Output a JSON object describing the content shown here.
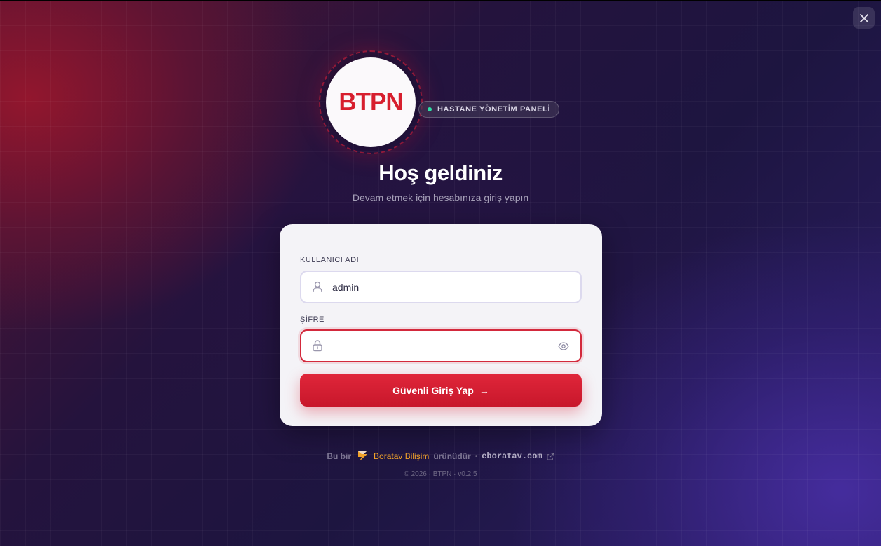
{
  "window": {
    "close_label": "✕"
  },
  "logo": {
    "text": "BTPN"
  },
  "badge": {
    "text": "HASTANE YÖNETİM PANELİ",
    "dot_color": "#2fe0a5"
  },
  "header": {
    "title": "Hoş geldiniz",
    "subtitle": "Devam etmek için hesabınıza giriş yapın"
  },
  "form": {
    "username": {
      "label": "KULLANICI ADI",
      "value": "admin",
      "icon": "user-icon"
    },
    "password": {
      "label": "ŞİFRE",
      "value": "",
      "icon": "lock-icon",
      "toggle_icon": "eye-icon"
    },
    "submit": {
      "label": "Güvenli Giriş Yap",
      "arrow": "→"
    }
  },
  "footer": {
    "prefix": "Bu bir",
    "brand": "Boratav Bilişim",
    "suffix": "ürünüdür",
    "separator": "•",
    "link": "eboratav.com",
    "copyright": "© 2026 · BTPN · v0.2.5"
  },
  "colors": {
    "accent": "#d71f2e",
    "brand_orange": "#f0a12a"
  }
}
